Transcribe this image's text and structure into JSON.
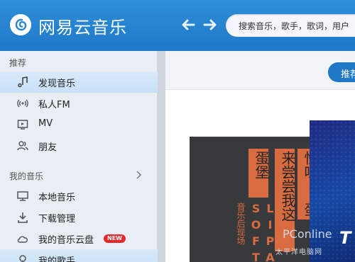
{
  "app": {
    "title": "网易云音乐"
  },
  "search": {
    "placeholder": "搜索音乐，歌手，歌词，用户"
  },
  "main": {
    "tab": "推荐"
  },
  "sidebar": {
    "section1": "推荐",
    "section2": "我的音乐",
    "items": [
      {
        "label": "发现音乐",
        "icon": "music-note-icon"
      },
      {
        "label": "私人FM",
        "icon": "radio-icon"
      },
      {
        "label": "MV",
        "icon": "video-icon"
      },
      {
        "label": "朋友",
        "icon": "friends-icon"
      },
      {
        "label": "本地音乐",
        "icon": "monitor-icon"
      },
      {
        "label": "下载管理",
        "icon": "download-icon"
      },
      {
        "label": "我的音乐云盘",
        "icon": "cloud-icon",
        "badge": "NEW"
      },
      {
        "label": "我的歌手",
        "icon": "singer-icon"
      }
    ]
  },
  "album": {
    "title_left": "蛋堡",
    "title_mid": "来尝尝我这",
    "title_right": "怪味",
    "title_right2": "蛋",
    "subtitle": "音乐后现场",
    "letters1": "SOFT",
    "letters2": "LIPA"
  },
  "watermark": {
    "brand": "PConline",
    "sub": "太平洋电脑网",
    "corner": "T"
  }
}
